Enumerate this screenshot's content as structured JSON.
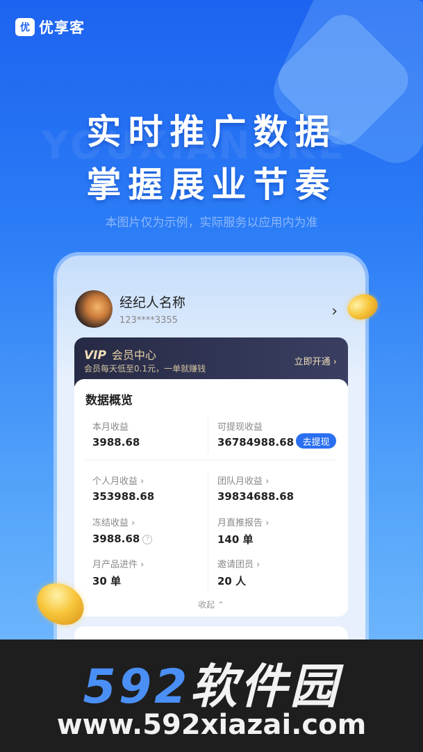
{
  "app": {
    "logo_icon": "优",
    "logo_text": "优享客"
  },
  "hero": {
    "line1": "实时推广数据",
    "line2": "掌握展业节奏",
    "disclaimer": "本图片仅为示例，实际服务以应用内为准",
    "watermark": "YOUXIANGKE"
  },
  "profile": {
    "name": "经纪人名称",
    "phone": "123****3355"
  },
  "vip": {
    "badge": "VIP",
    "title": "会员中心",
    "desc": "会员每天低至0.1元，一单就赚钱",
    "action": "立即开通 ›"
  },
  "overview": {
    "title": "数据概览",
    "month_income_label": "本月收益",
    "month_income": "3988.68",
    "withdrawable_label": "可提现收益",
    "withdrawable": "36784988.68",
    "withdraw_button": "去提现",
    "personal_label": "个人月收益 ›",
    "personal": "353988.68",
    "team_label": "团队月收益 ›",
    "team": "39834688.68",
    "frozen_label": "冻结收益 ›",
    "frozen": "3988.68",
    "report_label": "月直推报告 ›",
    "report": "140 单",
    "product_label": "月产品进件 ›",
    "product": "30 单",
    "invite_label": "邀请团员 ›",
    "invite": "20 人",
    "collapse": "收起 ⌃"
  },
  "footer": {
    "brand_num": "592",
    "brand_cn": "软件园",
    "url": "www.592xiazai.com"
  },
  "colors": {
    "primary": "#1d63f0",
    "vip_bg": "#262a44",
    "gold": "#e8d3a7"
  }
}
